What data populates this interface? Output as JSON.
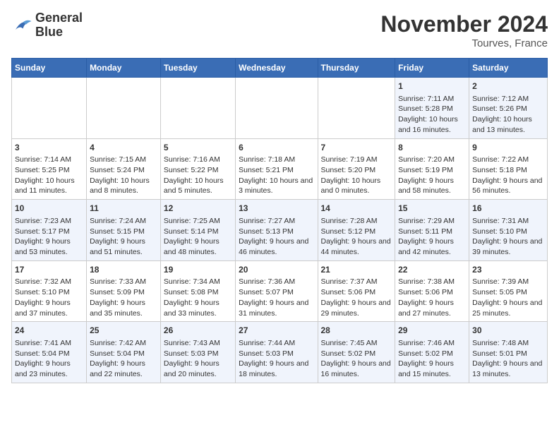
{
  "logo": {
    "line1": "General",
    "line2": "Blue"
  },
  "title": "November 2024",
  "subtitle": "Tourves, France",
  "headers": [
    "Sunday",
    "Monday",
    "Tuesday",
    "Wednesday",
    "Thursday",
    "Friday",
    "Saturday"
  ],
  "weeks": [
    [
      {
        "day": "",
        "info": ""
      },
      {
        "day": "",
        "info": ""
      },
      {
        "day": "",
        "info": ""
      },
      {
        "day": "",
        "info": ""
      },
      {
        "day": "",
        "info": ""
      },
      {
        "day": "1",
        "info": "Sunrise: 7:11 AM\nSunset: 5:28 PM\nDaylight: 10 hours and 16 minutes."
      },
      {
        "day": "2",
        "info": "Sunrise: 7:12 AM\nSunset: 5:26 PM\nDaylight: 10 hours and 13 minutes."
      }
    ],
    [
      {
        "day": "3",
        "info": "Sunrise: 7:14 AM\nSunset: 5:25 PM\nDaylight: 10 hours and 11 minutes."
      },
      {
        "day": "4",
        "info": "Sunrise: 7:15 AM\nSunset: 5:24 PM\nDaylight: 10 hours and 8 minutes."
      },
      {
        "day": "5",
        "info": "Sunrise: 7:16 AM\nSunset: 5:22 PM\nDaylight: 10 hours and 5 minutes."
      },
      {
        "day": "6",
        "info": "Sunrise: 7:18 AM\nSunset: 5:21 PM\nDaylight: 10 hours and 3 minutes."
      },
      {
        "day": "7",
        "info": "Sunrise: 7:19 AM\nSunset: 5:20 PM\nDaylight: 10 hours and 0 minutes."
      },
      {
        "day": "8",
        "info": "Sunrise: 7:20 AM\nSunset: 5:19 PM\nDaylight: 9 hours and 58 minutes."
      },
      {
        "day": "9",
        "info": "Sunrise: 7:22 AM\nSunset: 5:18 PM\nDaylight: 9 hours and 56 minutes."
      }
    ],
    [
      {
        "day": "10",
        "info": "Sunrise: 7:23 AM\nSunset: 5:17 PM\nDaylight: 9 hours and 53 minutes."
      },
      {
        "day": "11",
        "info": "Sunrise: 7:24 AM\nSunset: 5:15 PM\nDaylight: 9 hours and 51 minutes."
      },
      {
        "day": "12",
        "info": "Sunrise: 7:25 AM\nSunset: 5:14 PM\nDaylight: 9 hours and 48 minutes."
      },
      {
        "day": "13",
        "info": "Sunrise: 7:27 AM\nSunset: 5:13 PM\nDaylight: 9 hours and 46 minutes."
      },
      {
        "day": "14",
        "info": "Sunrise: 7:28 AM\nSunset: 5:12 PM\nDaylight: 9 hours and 44 minutes."
      },
      {
        "day": "15",
        "info": "Sunrise: 7:29 AM\nSunset: 5:11 PM\nDaylight: 9 hours and 42 minutes."
      },
      {
        "day": "16",
        "info": "Sunrise: 7:31 AM\nSunset: 5:10 PM\nDaylight: 9 hours and 39 minutes."
      }
    ],
    [
      {
        "day": "17",
        "info": "Sunrise: 7:32 AM\nSunset: 5:10 PM\nDaylight: 9 hours and 37 minutes."
      },
      {
        "day": "18",
        "info": "Sunrise: 7:33 AM\nSunset: 5:09 PM\nDaylight: 9 hours and 35 minutes."
      },
      {
        "day": "19",
        "info": "Sunrise: 7:34 AM\nSunset: 5:08 PM\nDaylight: 9 hours and 33 minutes."
      },
      {
        "day": "20",
        "info": "Sunrise: 7:36 AM\nSunset: 5:07 PM\nDaylight: 9 hours and 31 minutes."
      },
      {
        "day": "21",
        "info": "Sunrise: 7:37 AM\nSunset: 5:06 PM\nDaylight: 9 hours and 29 minutes."
      },
      {
        "day": "22",
        "info": "Sunrise: 7:38 AM\nSunset: 5:06 PM\nDaylight: 9 hours and 27 minutes."
      },
      {
        "day": "23",
        "info": "Sunrise: 7:39 AM\nSunset: 5:05 PM\nDaylight: 9 hours and 25 minutes."
      }
    ],
    [
      {
        "day": "24",
        "info": "Sunrise: 7:41 AM\nSunset: 5:04 PM\nDaylight: 9 hours and 23 minutes."
      },
      {
        "day": "25",
        "info": "Sunrise: 7:42 AM\nSunset: 5:04 PM\nDaylight: 9 hours and 22 minutes."
      },
      {
        "day": "26",
        "info": "Sunrise: 7:43 AM\nSunset: 5:03 PM\nDaylight: 9 hours and 20 minutes."
      },
      {
        "day": "27",
        "info": "Sunrise: 7:44 AM\nSunset: 5:03 PM\nDaylight: 9 hours and 18 minutes."
      },
      {
        "day": "28",
        "info": "Sunrise: 7:45 AM\nSunset: 5:02 PM\nDaylight: 9 hours and 16 minutes."
      },
      {
        "day": "29",
        "info": "Sunrise: 7:46 AM\nSunset: 5:02 PM\nDaylight: 9 hours and 15 minutes."
      },
      {
        "day": "30",
        "info": "Sunrise: 7:48 AM\nSunset: 5:01 PM\nDaylight: 9 hours and 13 minutes."
      }
    ]
  ]
}
